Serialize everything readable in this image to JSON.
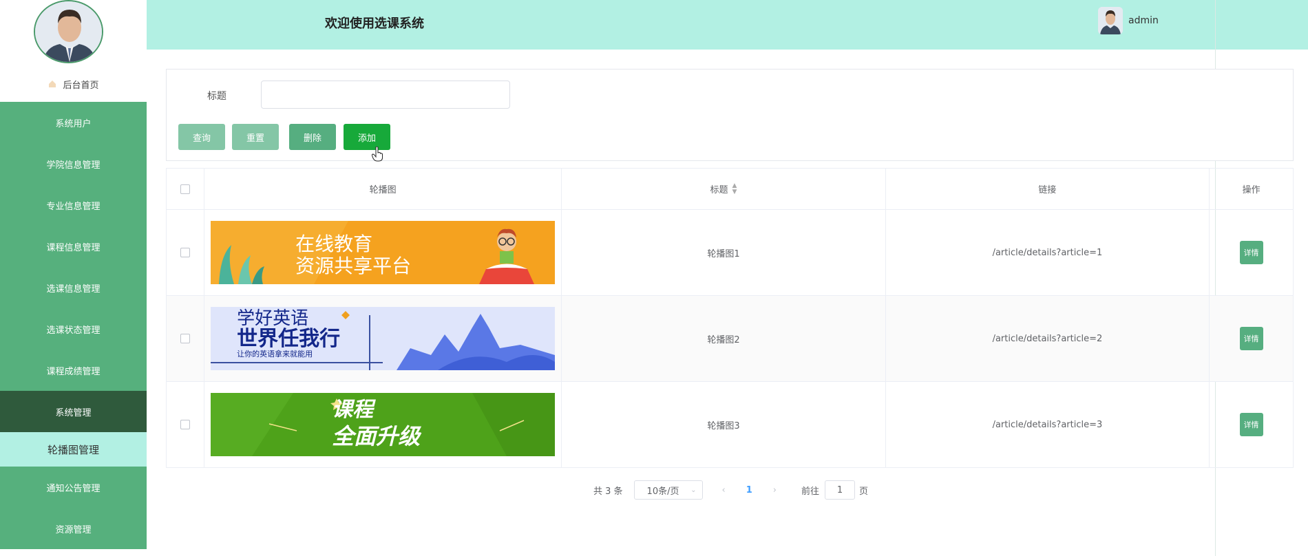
{
  "header": {
    "title": "欢迎使用选课系统",
    "username": "admin"
  },
  "sidebar": {
    "home_label": "后台首页",
    "items": [
      {
        "label": "系统用户"
      },
      {
        "label": "学院信息管理"
      },
      {
        "label": "专业信息管理"
      },
      {
        "label": "课程信息管理"
      },
      {
        "label": "选课信息管理"
      },
      {
        "label": "选课状态管理"
      },
      {
        "label": "课程成绩管理"
      },
      {
        "label": "系统管理"
      },
      {
        "label": "轮播图管理"
      },
      {
        "label": "通知公告管理"
      },
      {
        "label": "资源管理"
      }
    ]
  },
  "search": {
    "title_label": "标题",
    "title_value": "",
    "title_placeholder": ""
  },
  "toolbar": {
    "query": "查询",
    "reset": "重置",
    "delete": "删除",
    "add": "添加"
  },
  "table": {
    "columns": [
      "轮播图",
      "标题",
      "链接",
      "操作"
    ],
    "rows": [
      {
        "title": "轮播图1",
        "link": "/article/details?article=1",
        "action": "详情",
        "banner": {
          "line1": "在线教育",
          "line2": "资源共享平台"
        }
      },
      {
        "title": "轮播图2",
        "link": "/article/details?article=2",
        "action": "详情",
        "banner": {
          "line1": "学好英语",
          "line2": "世界任我行",
          "line3": "让你的英语拿来就能用"
        }
      },
      {
        "title": "轮播图3",
        "link": "/article/details?article=3",
        "action": "详情",
        "banner": {
          "line1": "课程",
          "line2": "全面升级"
        }
      }
    ]
  },
  "pagination": {
    "total": "共 3 条",
    "page_size": "10条/页",
    "current": "1",
    "goto_label": "前往",
    "goto_value": "1",
    "page_unit": "页"
  },
  "colors": {
    "sidebar": "#56b07d",
    "sidebar_active": "#2f5a3c",
    "header": "#b2f0e3",
    "add_button": "#17a93a"
  }
}
